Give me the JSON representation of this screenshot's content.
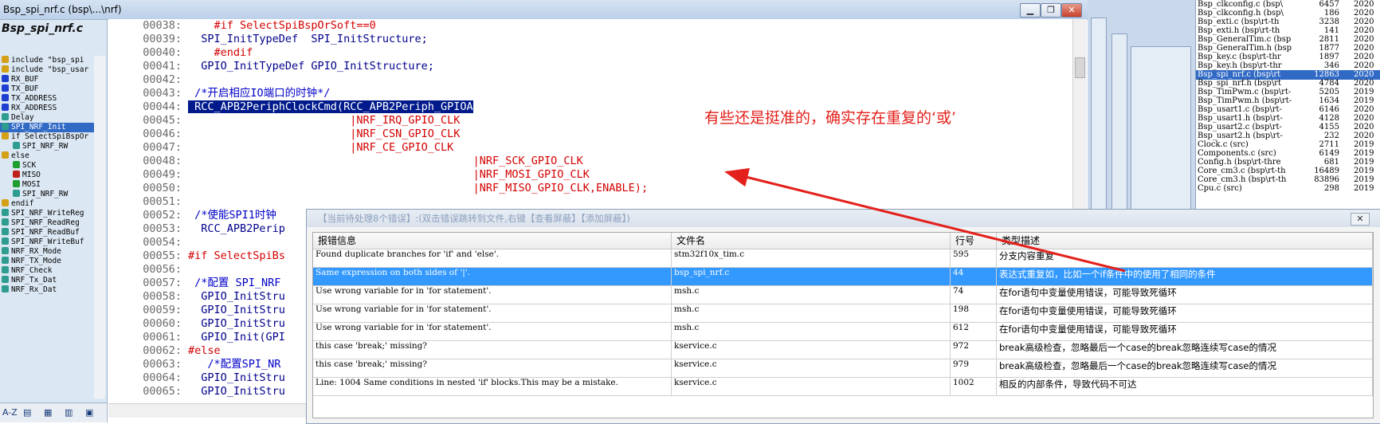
{
  "window": {
    "title": "Bsp_spi_nrf.c (bsp\\...\\nrf)",
    "min": "▁",
    "max": "❐",
    "close": "✕"
  },
  "left_panel": {
    "title": "Bsp_spi_nrf.c",
    "symbols": [
      {
        "label": "include \"bsp_spi",
        "icon": "include-icon",
        "color": "#d4a017",
        "indent": 0
      },
      {
        "label": "include \"bsp_usar",
        "icon": "include-icon",
        "color": "#d4a017",
        "indent": 0
      },
      {
        "label": "RX_BUF",
        "icon": "variable-icon",
        "color": "#1e3fd0",
        "indent": 0
      },
      {
        "label": "TX_BUF",
        "icon": "variable-icon",
        "color": "#1e3fd0",
        "indent": 0
      },
      {
        "label": "TX_ADDRESS",
        "icon": "variable-icon",
        "color": "#1e3fd0",
        "indent": 0
      },
      {
        "label": "RX_ADDRESS",
        "icon": "variable-icon",
        "color": "#1e3fd0",
        "indent": 0
      },
      {
        "label": "Delay",
        "icon": "function-icon",
        "color": "#2e9c8f",
        "indent": 0
      },
      {
        "label": "SPI_NRF_Init",
        "icon": "function-icon",
        "color": "#2e9c8f",
        "indent": 0,
        "selected": true
      },
      {
        "label": "if SelectSpiBspOr",
        "icon": "condition-icon",
        "color": "#d4a017",
        "indent": 0
      },
      {
        "label": "SPI_NRF_RW",
        "icon": "function-icon",
        "color": "#2e9c8f",
        "indent": 1
      },
      {
        "label": "else",
        "icon": "condition-icon",
        "color": "#d4a017",
        "indent": 0
      },
      {
        "label": "SCK",
        "icon": "macro-icon",
        "color": "#1f9d2f",
        "indent": 1
      },
      {
        "label": "MISO",
        "icon": "macro-red-icon",
        "color": "#c0201a",
        "indent": 1
      },
      {
        "label": "MOSI",
        "icon": "macro-icon",
        "color": "#1f9d2f",
        "indent": 1
      },
      {
        "label": "SPI_NRF_RW",
        "icon": "function-icon",
        "color": "#2e9c8f",
        "indent": 1
      },
      {
        "label": "endif",
        "icon": "condition-icon",
        "color": "#d4a017",
        "indent": 0
      },
      {
        "label": "SPI_NRF_WriteReg",
        "icon": "function-icon",
        "color": "#2e9c8f",
        "indent": 0
      },
      {
        "label": "SPI_NRF_ReadReg",
        "icon": "function-icon",
        "color": "#2e9c8f",
        "indent": 0
      },
      {
        "label": "SPI_NRF_ReadBuf",
        "icon": "function-icon",
        "color": "#2e9c8f",
        "indent": 0
      },
      {
        "label": "SPI_NRF_WriteBuf",
        "icon": "function-icon",
        "color": "#2e9c8f",
        "indent": 0
      },
      {
        "label": "NRF_RX_Mode",
        "icon": "function-icon",
        "color": "#2e9c8f",
        "indent": 0
      },
      {
        "label": "NRF_TX_Mode",
        "icon": "function-icon",
        "color": "#2e9c8f",
        "indent": 0
      },
      {
        "label": "NRF_Check",
        "icon": "function-icon",
        "color": "#2e9c8f",
        "indent": 0
      },
      {
        "label": "NRF_Tx_Dat",
        "icon": "function-icon",
        "color": "#2e9c8f",
        "indent": 0
      },
      {
        "label": "NRF_Rx_Dat",
        "icon": "function-icon",
        "color": "#2e9c8f",
        "indent": 0
      }
    ],
    "bottom_tools": [
      "A-Z",
      "▤",
      "▦",
      "▥",
      "▣"
    ]
  },
  "code_lines": [
    {
      "num": "00038:",
      "text": "    #if SelectSpiBspOrSoft==0",
      "color": "#d40000"
    },
    {
      "num": "00039:",
      "text": "  SPI_InitTypeDef  SPI_InitStructure;",
      "color": "#00008b"
    },
    {
      "num": "00040:",
      "text": "    #endif",
      "color": "#d40000"
    },
    {
      "num": "00041:",
      "text": "  GPIO_InitTypeDef GPIO_InitStructure;",
      "color": "#00008b"
    },
    {
      "num": "00042:",
      "text": "",
      "color": "#000"
    },
    {
      "num": "00043:",
      "text": " /*开启相应IO端口的时钟*/",
      "color": "#0000c8"
    },
    {
      "num": "00044:",
      "text": " RCC_APB2PeriphClockCmd(RCC_APB2Periph_GPIOA",
      "color": "#ffffff",
      "highlight": true
    },
    {
      "num": "00045:",
      "text": "                         |NRF_IRQ_GPIO_CLK",
      "color": "#d40000"
    },
    {
      "num": "00046:",
      "text": "                         |NRF_CSN_GPIO_CLK",
      "color": "#d40000"
    },
    {
      "num": "00047:",
      "text": "                         |NRF_CE_GPIO_CLK",
      "color": "#d40000"
    },
    {
      "num": "00048:",
      "text": "                                            |NRF_SCK_GPIO_CLK",
      "color": "#d40000"
    },
    {
      "num": "00049:",
      "text": "                                            |NRF_MOSI_GPIO_CLK",
      "color": "#d40000"
    },
    {
      "num": "00050:",
      "text": "                                            |NRF_MISO_GPIO_CLK,ENABLE);",
      "color": "#d40000"
    },
    {
      "num": "00051:",
      "text": "",
      "color": "#000"
    },
    {
      "num": "00052:",
      "text": " /*使能SPI1时钟",
      "color": "#0000c8"
    },
    {
      "num": "00053:",
      "text": "  RCC_APB2Perip",
      "color": "#00008b"
    },
    {
      "num": "00054:",
      "text": "",
      "color": "#000"
    },
    {
      "num": "00055:",
      "text": "#if SelectSpiBs",
      "color": "#d40000"
    },
    {
      "num": "00056:",
      "text": "",
      "color": "#000"
    },
    {
      "num": "00057:",
      "text": " /*配置 SPI_NRF",
      "color": "#0000c8"
    },
    {
      "num": "00058:",
      "text": "  GPIO_InitStru",
      "color": "#00008b"
    },
    {
      "num": "00059:",
      "text": "  GPIO_InitStru",
      "color": "#00008b"
    },
    {
      "num": "00060:",
      "text": "  GPIO_InitStru",
      "color": "#00008b"
    },
    {
      "num": "00061:",
      "text": "  GPIO_Init(GPI",
      "color": "#00008b"
    },
    {
      "num": "00062:",
      "text": "#else",
      "color": "#d40000"
    },
    {
      "num": "00063:",
      "text": "   /*配置SPI_NR",
      "color": "#0000c8"
    },
    {
      "num": "00064:",
      "text": "  GPIO_InitStru",
      "color": "#00008b"
    },
    {
      "num": "00065:",
      "text": "  GPIO_InitStru",
      "color": "#00008b"
    }
  ],
  "annotation": "有些还是挺准的，确实存在重复的‘或’",
  "file_list": [
    {
      "name": "Bsp_clkconfig.c (bsp\\",
      "size": "6457",
      "date": "2020",
      "selected": false
    },
    {
      "name": "Bsp_clkconfig.h (bsp\\",
      "size": "186",
      "date": "2020"
    },
    {
      "name": "Bsp_exti.c (bsp\\rt-th",
      "size": "3238",
      "date": "2020"
    },
    {
      "name": "Bsp_exti.h (bsp\\rt-th",
      "size": "141",
      "date": "2020"
    },
    {
      "name": "Bsp_GeneralTim.c (bsp",
      "size": "2811",
      "date": "2020"
    },
    {
      "name": "Bsp_GeneralTim.h (bsp",
      "size": "1877",
      "date": "2020"
    },
    {
      "name": "Bsp_key.c (bsp\\rt-thr",
      "size": "1897",
      "date": "2020"
    },
    {
      "name": "Bsp_key.h (bsp\\rt-thr",
      "size": "346",
      "date": "2020"
    },
    {
      "name": "Bsp_spi_nrf.c (bsp\\rt",
      "size": "12863",
      "date": "2020",
      "selected": true
    },
    {
      "name": "Bsp_spi_nrf.h (bsp\\rt",
      "size": "4784",
      "date": "2020"
    },
    {
      "name": "Bsp_TimPwm.c (bsp\\rt-",
      "size": "5205",
      "date": "2019"
    },
    {
      "name": "Bsp_TimPwm.h (bsp\\rt-",
      "size": "1634",
      "date": "2019"
    },
    {
      "name": "Bsp_usart1.c (bsp\\rt-",
      "size": "6146",
      "date": "2020"
    },
    {
      "name": "Bsp_usart1.h (bsp\\rt-",
      "size": "4128",
      "date": "2020"
    },
    {
      "name": "Bsp_usart2.c (bsp\\rt-",
      "size": "4155",
      "date": "2020"
    },
    {
      "name": "Bsp_usart2.h (bsp\\rt-",
      "size": "232",
      "date": "2020"
    },
    {
      "name": "Clock.c (src)",
      "size": "2711",
      "date": "2019"
    },
    {
      "name": "Components.c (src)",
      "size": "6149",
      "date": "2019"
    },
    {
      "name": "Config.h (bsp\\rt-thre",
      "size": "681",
      "date": "2019"
    },
    {
      "name": "Core_cm3.c (bsp\\rt-th",
      "size": "16489",
      "date": "2019"
    },
    {
      "name": "Core_cm3.h (bsp\\rt-th",
      "size": "83896",
      "date": "2019"
    },
    {
      "name": "Cpu.c (src)",
      "size": "298",
      "date": "2019"
    }
  ],
  "dialog": {
    "title": "【当前待处理8个错误】:(双击错误跳转到文件,右键【查看屏蔽】【添加屏蔽】)",
    "close": "✕",
    "headers": [
      "报错信息",
      "文件名",
      "行号",
      "类型描述"
    ],
    "rows": [
      {
        "msg": "Found duplicate branches for 'if' and 'else'.",
        "file": "stm32f10x_tim.c",
        "line": "595",
        "desc": "分支内容重复"
      },
      {
        "msg": "Same expression on both sides of '|'.",
        "file": "bsp_spi_nrf.c",
        "line": "44",
        "desc": "表达式重复如，比如一个if条件中的使用了相同的条件",
        "selected": true
      },
      {
        "msg": "Use wrong variable for in 'for statement'.",
        "file": "msh.c",
        "line": "74",
        "desc": "在for语句中变量使用错误，可能导致死循环"
      },
      {
        "msg": "Use wrong variable for in 'for statement'.",
        "file": "msh.c",
        "line": "198",
        "desc": "在for语句中变量使用错误，可能导致死循环"
      },
      {
        "msg": "Use wrong variable for in 'for statement'.",
        "file": "msh.c",
        "line": "612",
        "desc": "在for语句中变量使用错误，可能导致死循环"
      },
      {
        "msg": "this case  'break;' missing?",
        "file": "kservice.c",
        "line": "972",
        "desc": "break高级检查，忽略最后一个case的break忽略连续写case的情况"
      },
      {
        "msg": "this case  'break;' missing?",
        "file": "kservice.c",
        "line": "979",
        "desc": "break高级检查，忽略最后一个case的break忽略连续写case的情况"
      },
      {
        "msg": "Line: 1004 Same conditions in nested 'if' blocks.This may be a mistake.",
        "file": "kservice.c",
        "line": "1002",
        "desc": "相反的内部条件，导致代码不可达"
      }
    ]
  }
}
